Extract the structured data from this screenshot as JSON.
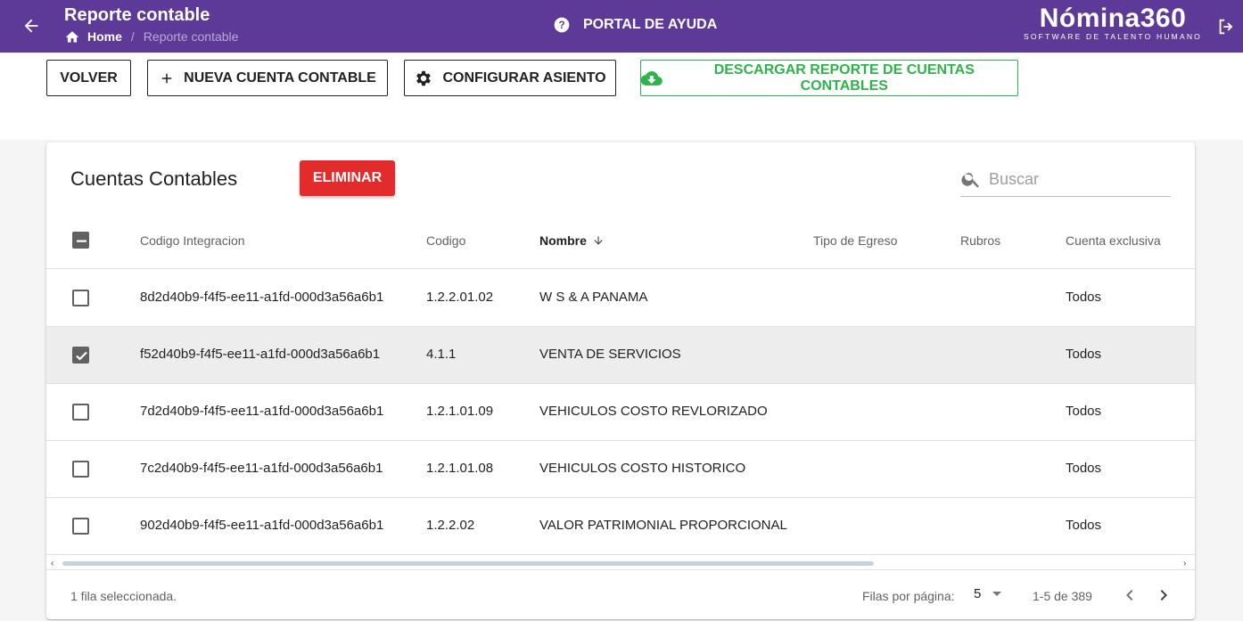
{
  "header": {
    "title": "Reporte contable",
    "breadcrumb": {
      "home": "Home",
      "separator": "/",
      "current": "Reporte contable"
    },
    "help": "PORTAL DE AYUDA",
    "logo": {
      "brand": "Nómina360",
      "tagline": "SOFTWARE DE TALENTO HUMANO"
    },
    "color": "#5e3a98"
  },
  "toolbar": {
    "volver": "VOLVER",
    "nueva": "NUEVA CUENTA CONTABLE",
    "configurar": "CONFIGURAR ASIENTO",
    "descargar": "DESCARGAR REPORTE DE CUENTAS CONTABLES"
  },
  "card": {
    "title": "Cuentas Contables",
    "eliminar": "ELIMINAR",
    "search_placeholder": "Buscar"
  },
  "table": {
    "columns": [
      "Codigo Integracion",
      "Codigo",
      "Nombre",
      "Tipo de Egreso",
      "Rubros",
      "Cuenta exclusiva"
    ],
    "rows": [
      {
        "checked": false,
        "integracion": "8d2d40b9-f4f5-ee11-a1fd-000d3a56a6b1",
        "codigo": "1.2.2.01.02",
        "nombre": "W S & A PANAMA",
        "tipo": "",
        "rubros": "",
        "exclusiva": "Todos"
      },
      {
        "checked": true,
        "integracion": "f52d40b9-f4f5-ee11-a1fd-000d3a56a6b1",
        "codigo": "4.1.1",
        "nombre": "VENTA DE SERVICIOS",
        "tipo": "",
        "rubros": "",
        "exclusiva": "Todos"
      },
      {
        "checked": false,
        "integracion": "7d2d40b9-f4f5-ee11-a1fd-000d3a56a6b1",
        "codigo": "1.2.1.01.09",
        "nombre": "VEHICULOS COSTO REVLORIZADO",
        "tipo": "",
        "rubros": "",
        "exclusiva": "Todos"
      },
      {
        "checked": false,
        "integracion": "7c2d40b9-f4f5-ee11-a1fd-000d3a56a6b1",
        "codigo": "1.2.1.01.08",
        "nombre": "VEHICULOS COSTO HISTORICO",
        "tipo": "",
        "rubros": "",
        "exclusiva": "Todos"
      },
      {
        "checked": false,
        "integracion": "902d40b9-f4f5-ee11-a1fd-000d3a56a6b1",
        "codigo": "1.2.2.02",
        "nombre": "VALOR PATRIMONIAL PROPORCIONAL",
        "tipo": "",
        "rubros": "",
        "exclusiva": "Todos"
      }
    ]
  },
  "footer": {
    "selected": "1 fila seleccionada.",
    "rows_per_page_label": "Filas por página:",
    "rows_per_page": "5",
    "range": "1-5 de 389"
  }
}
